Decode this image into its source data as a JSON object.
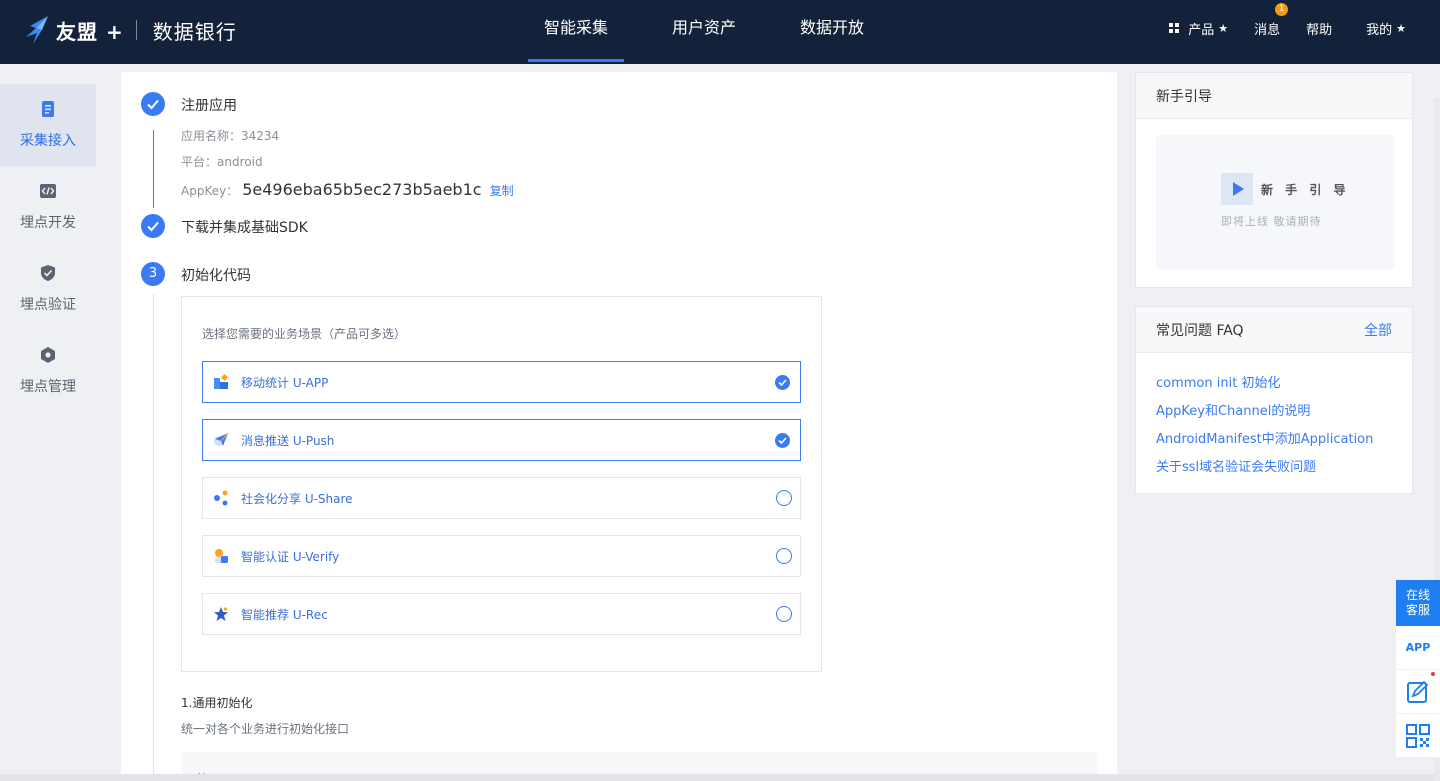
{
  "header": {
    "brand": "友盟 +",
    "product": "数据银行",
    "nav": [
      {
        "label": "智能采集",
        "active": true
      },
      {
        "label": "用户资产",
        "active": false
      },
      {
        "label": "数据开放",
        "active": false
      }
    ],
    "right": {
      "products": "产品",
      "messages": "消息",
      "message_badge": "1",
      "help": "帮助",
      "mine": "我的"
    }
  },
  "sidebar": {
    "items": [
      {
        "label": "采集接入",
        "icon": "document-icon",
        "active": true
      },
      {
        "label": "埋点开发",
        "icon": "code-icon",
        "active": false
      },
      {
        "label": "埋点验证",
        "icon": "shield-check-icon",
        "active": false
      },
      {
        "label": "埋点管理",
        "icon": "settings-icon",
        "active": false
      }
    ]
  },
  "steps": {
    "step1": {
      "title": "注册应用",
      "app_name_label": "应用名称：",
      "app_name": "34234",
      "platform_label": "平台：",
      "platform": "android",
      "appkey_label": "AppKey：",
      "appkey": "5e496eba65b5ec273b5aeb1c",
      "copy": "复制"
    },
    "step2": {
      "title": "下载并集成基础SDK"
    },
    "step3": {
      "number": "3",
      "title": "初始化代码",
      "scene_hint": "选择您需要的业务场景（产品可多选）",
      "options": [
        {
          "label": "移动统计 U-APP",
          "checked": true
        },
        {
          "label": "消息推送 U-Push",
          "checked": true
        },
        {
          "label": "社会化分享 U-Share",
          "checked": false
        },
        {
          "label": "智能认证 U-Verify",
          "checked": false
        },
        {
          "label": "智能推荐 U-Rec",
          "checked": false
        }
      ],
      "section_title": "1.通用初始化",
      "section_desc": "统一对各个业务进行初始化接口",
      "code_header": "接口"
    }
  },
  "guide": {
    "title": "新手引导",
    "card_title": "新 手 引 导",
    "card_sub": "即将上线  敬请期待"
  },
  "faq": {
    "title": "常见问题 FAQ",
    "all": "全部",
    "items": [
      "common init 初始化",
      "AppKey和Channel的说明",
      "AndroidManifest中添加Application",
      "关于ssl域名验证会失败问题"
    ]
  },
  "float": {
    "service_line1": "在线",
    "service_line2": "客服",
    "app": "APP"
  },
  "colors": {
    "topbar": "#13223a",
    "accent": "#3a7bf4",
    "float_accent": "#1f7ff0"
  }
}
